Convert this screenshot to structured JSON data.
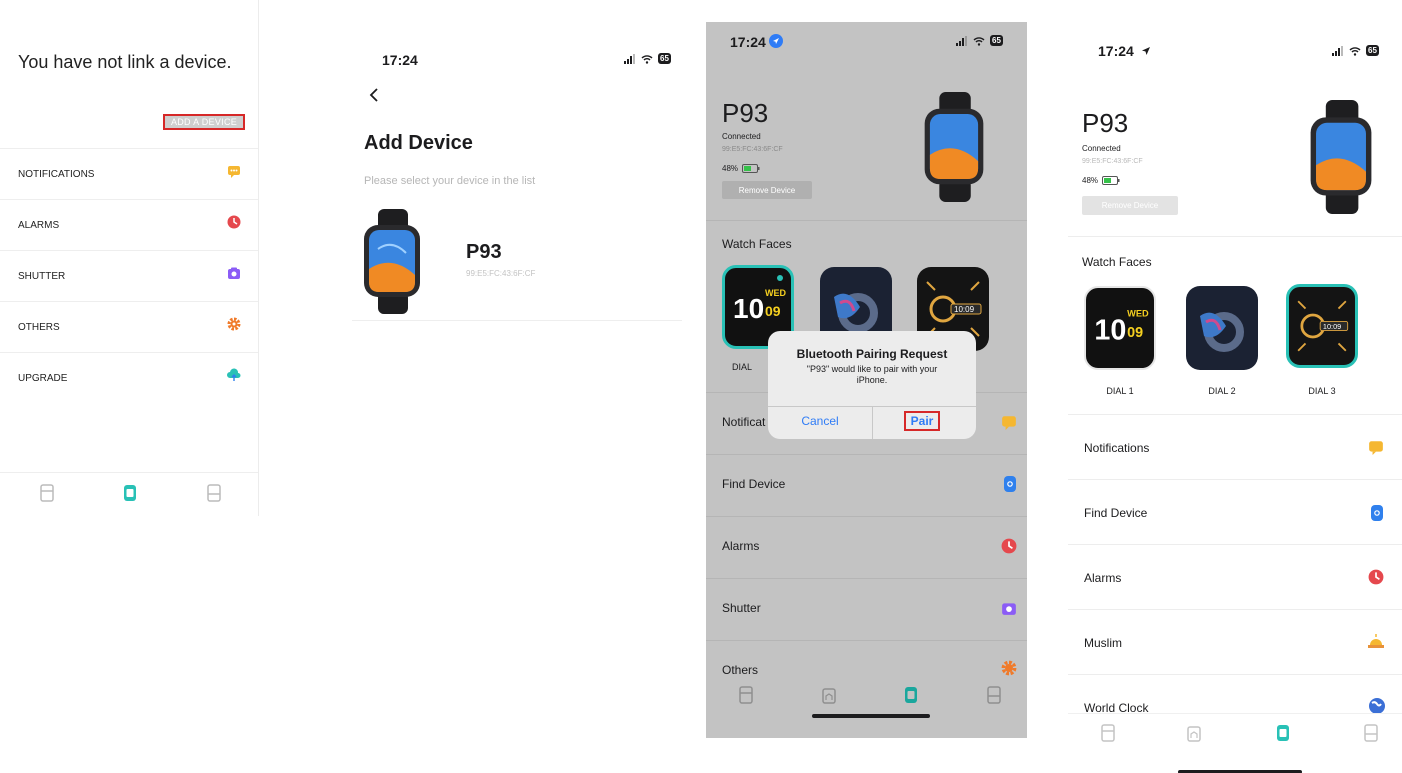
{
  "panel1": {
    "title": "You have not link a device.",
    "add_device_label": "ADD A DEVICE",
    "menu": [
      {
        "label": "NOTIFICATIONS",
        "icon": "message-icon",
        "color": "#f5b731"
      },
      {
        "label": "ALARMS",
        "icon": "clock-icon",
        "color": "#e5484d"
      },
      {
        "label": "SHUTTER",
        "icon": "camera-icon",
        "color": "#8b5cf6"
      },
      {
        "label": "OTHERS",
        "icon": "gear-icon",
        "color": "#f07a2a"
      },
      {
        "label": "UPGRADE",
        "icon": "cloud-upload-icon",
        "color": "#29c1b6"
      }
    ]
  },
  "panel2": {
    "time": "17:24",
    "battery": "65",
    "title": "Add Device",
    "subtitle": "Please select your device in the list",
    "device": {
      "name": "P93",
      "mac": "99:E5:FC:43:6F:CF"
    }
  },
  "panel3": {
    "time": "17:24",
    "battery": "65",
    "device_name": "P93",
    "status": "Connected",
    "mac": "99:E5:FC:43:6F:CF",
    "battery_pct": "48%",
    "remove_label": "Remove Device",
    "watch_faces_label": "Watch Faces",
    "dial_1": "DIAL",
    "items": [
      "Notificat",
      "Find Device",
      "Alarms",
      "Shutter",
      "Others"
    ],
    "dialog": {
      "title": "Bluetooth Pairing Request",
      "message": "\"P93\" would like to pair with your iPhone.",
      "cancel": "Cancel",
      "pair": "Pair"
    }
  },
  "panel4": {
    "time": "17:24",
    "battery": "65",
    "device_name": "P93",
    "status": "Connected",
    "mac": "99:E5:FC:43:6F:CF",
    "battery_pct": "48%",
    "remove_label": "Remove Device",
    "watch_faces_label": "Watch Faces",
    "dials": [
      "DIAL 1",
      "DIAL 2",
      "DIAL 3"
    ],
    "items": [
      {
        "label": "Notifications",
        "icon": "message-icon",
        "color": "#f5b731"
      },
      {
        "label": "Find Device",
        "icon": "find-device-icon",
        "color": "#2f80ed"
      },
      {
        "label": "Alarms",
        "icon": "clock-icon",
        "color": "#e5484d"
      },
      {
        "label": "Muslim",
        "icon": "mosque-icon",
        "color": "#f5b731"
      },
      {
        "label": "World Clock",
        "icon": "globe-icon",
        "color": "#3b6fd6"
      }
    ]
  },
  "dial_digits": {
    "hour": "10",
    "day": "WED",
    "min": "09",
    "digital": "10:09"
  },
  "colors": {
    "accent": "#29c1b6",
    "pair_highlight": "#d62828",
    "link_blue": "#2f7cf6"
  }
}
